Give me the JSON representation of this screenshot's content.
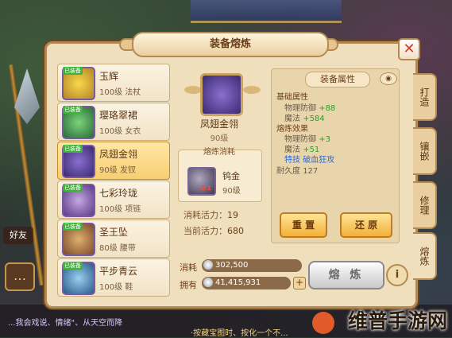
{
  "window": {
    "title": "装备熔炼",
    "close_symbol": "✕"
  },
  "side": {
    "badge": "好友",
    "chat_symbol": "…"
  },
  "chat": {
    "line1": "...我会戏说、情绪\"、从天空而降",
    "line2": "·按藏宝图时、按化一个不..."
  },
  "items": [
    {
      "tag": "已装备",
      "name": "玉辉",
      "level": "100级",
      "type": "法杖"
    },
    {
      "tag": "已装备",
      "name": "璎珞翠裙",
      "level": "100级",
      "type": "女衣"
    },
    {
      "tag": "已装备",
      "name": "凤翅金翎",
      "level": "90级",
      "type": "发钗"
    },
    {
      "tag": "已装备",
      "name": "七彩玲珑",
      "level": "100级",
      "type": "项链"
    },
    {
      "tag": "已装备",
      "name": "圣王坠",
      "level": "80级",
      "type": "腰带"
    },
    {
      "tag": "已装备",
      "name": "平步青云",
      "level": "100级",
      "type": "鞋"
    }
  ],
  "selected_index": 2,
  "equip": {
    "name": "凤翅金翎",
    "level": "90级",
    "cost_header": "熔炼消耗",
    "ore_name": "钨金",
    "ore_level": "90级",
    "ore_count": "0/1",
    "vitality_cost_label": "消耗活力：",
    "vitality_cost": "19",
    "vitality_current_label": "当前活力：",
    "vitality_current": "680"
  },
  "attributes": {
    "header": "装备属性",
    "eye_symbol": "◉",
    "base_title": "基础属性",
    "base": [
      {
        "name": "物理防御",
        "value": "+88"
      },
      {
        "name": "魔法",
        "value": "+584"
      }
    ],
    "effect_title": "熔炼效果",
    "effects": [
      {
        "name": "物理防御",
        "value": "+3"
      },
      {
        "name": "魔法",
        "value": "+51"
      }
    ],
    "skill_label": "特技",
    "skill_value": "破血狂攻",
    "durability_label": "耐久度",
    "durability_value": "127"
  },
  "buttons": {
    "reset": "重 置",
    "restore": "还 原",
    "refine": "熔 炼",
    "info": "i",
    "plus": "+"
  },
  "bottom": {
    "consume_label": "消耗",
    "consume_value": "302,500",
    "own_label": "拥有",
    "own_value": "41,415,931"
  },
  "tabs": [
    "打造",
    "镶嵌",
    "修理",
    "熔炼"
  ],
  "active_tab": 3,
  "watermark": "维普手游网",
  "colors": {
    "accent": "#f2b03a",
    "panel": "#f0dfbd",
    "green": "#2aa02a",
    "blue": "#2a6ad6"
  }
}
